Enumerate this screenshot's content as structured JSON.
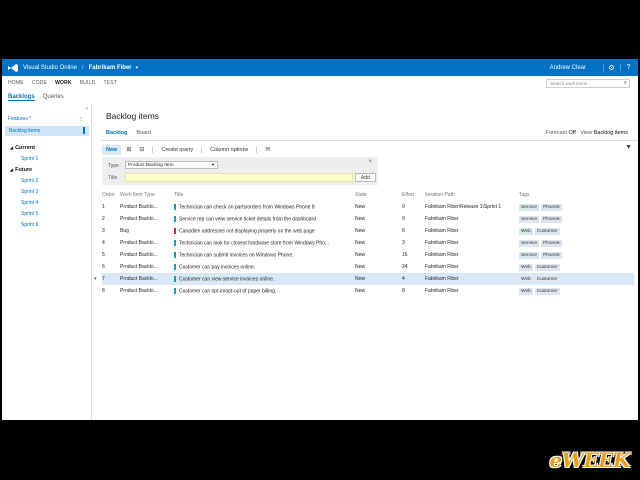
{
  "topbar": {
    "brand": "Visual Studio Online",
    "separator": "/",
    "project": "Fabrikam Fiber",
    "project_caret": "▾",
    "user": "Andrew Clear",
    "icons": [
      "settings-gear-icon",
      "help-icon"
    ],
    "bg_color": "#0072c6"
  },
  "hubs": [
    "HOME",
    "CODE",
    "WORK",
    "BUILD",
    "TEST"
  ],
  "hubs_active": "WORK",
  "search": {
    "placeholder": "Search work items"
  },
  "subnav": {
    "items": [
      "Backlogs",
      "Queries"
    ],
    "active": "Backlogs"
  },
  "sidebar": {
    "collapse_glyph": "‹",
    "features": "Features *",
    "backlog_items": "Backlog items",
    "current_label": "Current",
    "current_sprints": [
      "Sprint 1"
    ],
    "future_label": "Future",
    "future_sprints": [
      "Sprint 2",
      "Sprint 3",
      "Sprint 4",
      "Sprint 5",
      "Sprint 6"
    ]
  },
  "main": {
    "title": "Backlog items",
    "pivots": [
      "Backlog",
      "Board"
    ],
    "forecast_label": "Forecast",
    "forecast_value": "Off",
    "view_label": "View",
    "view_value": "Backlog items"
  },
  "toolbar": {
    "new": "New",
    "create_query": "Create query",
    "column_options": "Column options"
  },
  "add_panel": {
    "type_label": "Type",
    "type_value": "Product Backlog Item",
    "title_label": "Title",
    "title_value": "",
    "add_button": "Add",
    "close": "×"
  },
  "table": {
    "headers": [
      "Order",
      "Work Item Type",
      "Title",
      "State",
      "Effort",
      "Iteration Path",
      "Tags"
    ],
    "rows": [
      {
        "order": "1",
        "type": "Product Backlo...",
        "stripe": "#009ccc",
        "title": "Technician can check on parts/orders from Windows Phone 8",
        "state": "New",
        "effort": "9",
        "path": "Fabrikam Fiber\\Release 1\\Sprint 1",
        "tags": [
          "Service",
          "Phone8"
        ]
      },
      {
        "order": "2",
        "type": "Product Backlo...",
        "stripe": "#009ccc",
        "title": "Service rep can veiw service ticket details from the dashboard",
        "state": "New",
        "effort": "9",
        "path": "Fabrikam Fiber",
        "tags": [
          "Service",
          "Phone8"
        ]
      },
      {
        "order": "3",
        "type": "Bug",
        "stripe": "#cc293d",
        "title": "Canadien addresses not displaying properly on the web page",
        "state": "New",
        "effort": "6",
        "path": "Fabrikam Fiber",
        "tags": [
          "Web",
          "Customer"
        ]
      },
      {
        "order": "4",
        "type": "Product Backlo...",
        "stripe": "#009ccc",
        "title": "Technician can look for closest hardware store from Windows Pho...",
        "state": "New",
        "effort": "3",
        "path": "Fabrikam Fiber",
        "tags": [
          "Service",
          "Phone8"
        ]
      },
      {
        "order": "5",
        "type": "Product Backlo...",
        "stripe": "#009ccc",
        "title": "Technician can submit invoices on Windows Phone.",
        "state": "New",
        "effort": "16",
        "path": "Fabrikam Fiber",
        "tags": [
          "Service",
          "Phone8"
        ]
      },
      {
        "order": "6",
        "type": "Product Backlo...",
        "stripe": "#009ccc",
        "title": "Customer can pay invoices online.",
        "state": "New",
        "effort": "24",
        "path": "Fabrikam Fiber",
        "tags": [
          "Web",
          "Customer"
        ]
      },
      {
        "order": "7",
        "type": "Product Backlo...",
        "stripe": "#009ccc",
        "title": "Customer can view service invoices online.",
        "state": "New",
        "effort": "4",
        "path": "Fabrikam Fiber",
        "tags": [
          "Web",
          "Customer"
        ],
        "selected": true,
        "marker": "▾"
      },
      {
        "order": "8",
        "type": "Product Backlo...",
        "stripe": "#009ccc",
        "title": "Customer can opt-in/opt-out of paper billing.",
        "state": "New",
        "effort": "8",
        "path": "Fabrikam Fiber",
        "tags": [
          "Web",
          "Customer"
        ]
      }
    ]
  },
  "watermark": "eWEEK"
}
